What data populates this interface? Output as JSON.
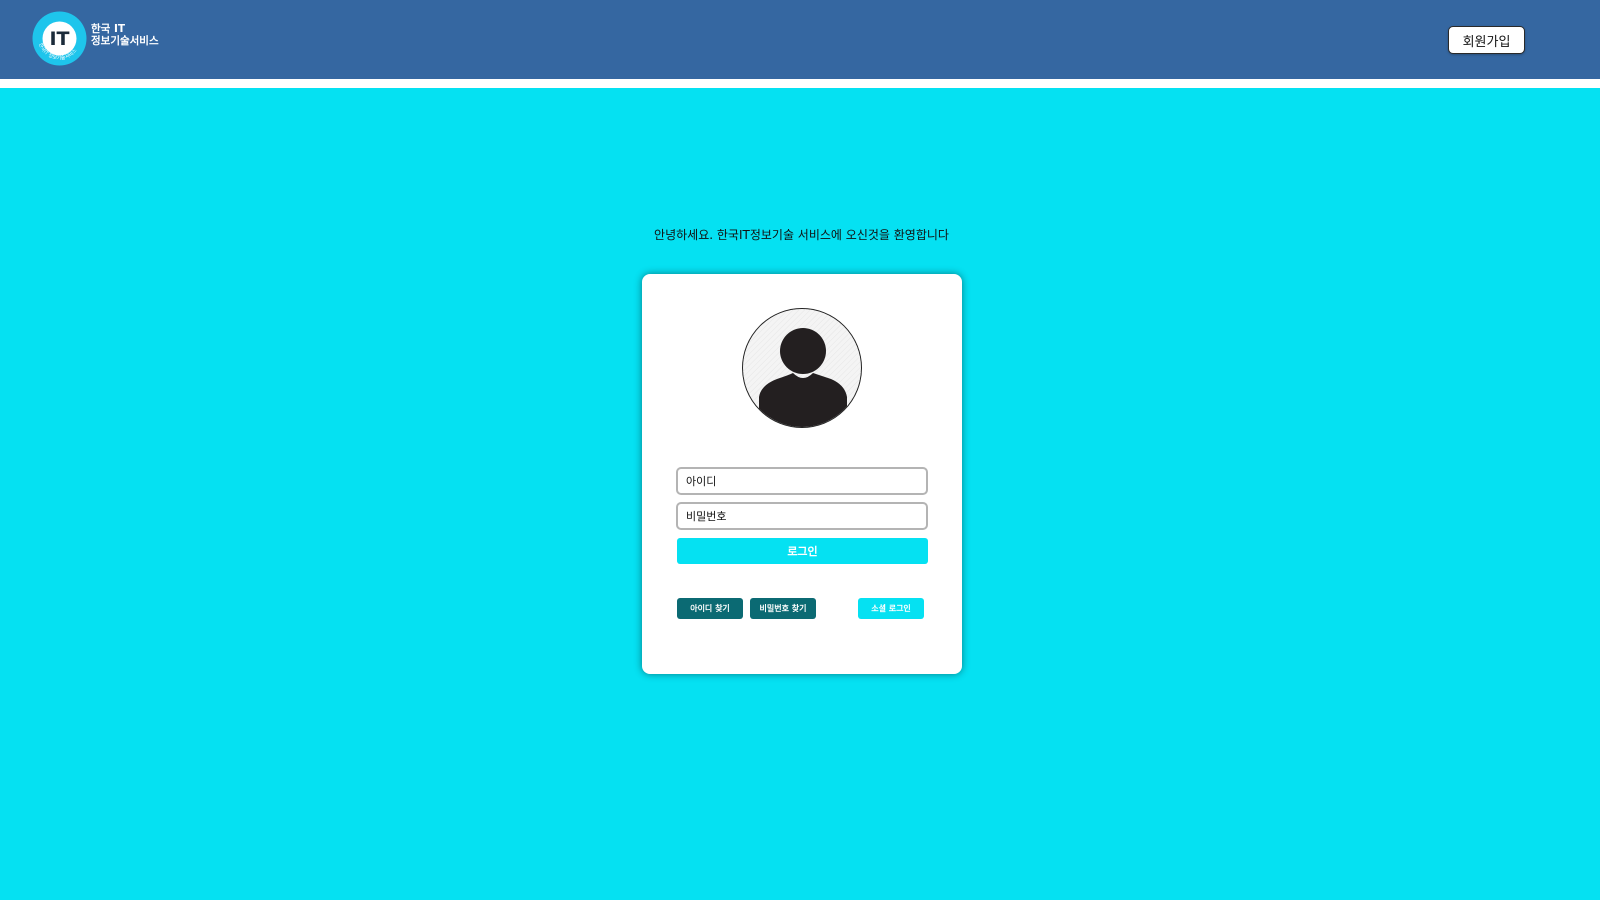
{
  "header": {
    "logo": {
      "badge_text": "IT",
      "ring_text": "한국IT 정보기술서비스",
      "line1": "한국 IT",
      "line2": "정보기술서비스",
      "icon": "it-logo-icon"
    },
    "signup_label": "회원가입"
  },
  "main": {
    "welcome": "안녕하세요. 한국IT정보기술 서비스에 오신것을 환영합니다"
  },
  "login_card": {
    "avatar_icon": "user-silhouette-icon",
    "id_placeholder": "아이디",
    "pw_placeholder": "비밀번호",
    "login_label": "로그인",
    "find_id_label": "아이디 찾기",
    "find_pw_label": "비밀번호 찾기",
    "social_label": "소셜 로그인"
  },
  "colors": {
    "header_bg": "#3567a1",
    "main_bg": "#05e1f2",
    "secondary_button": "#0b6a73",
    "card_bg": "#ffffff"
  }
}
